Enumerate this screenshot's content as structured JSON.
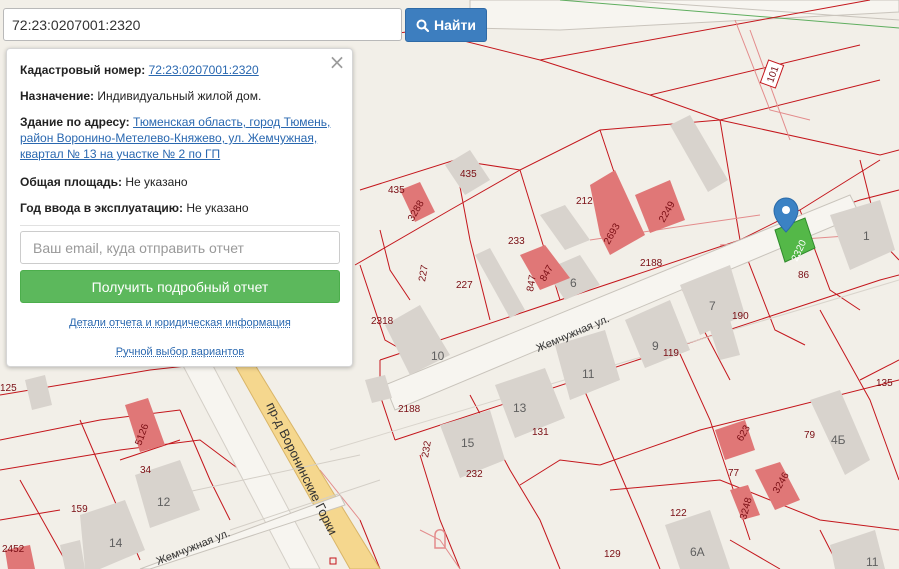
{
  "search": {
    "value": "72:23:0207001:2320",
    "button_label": "Найти"
  },
  "info_panel": {
    "cadastral_label": "Кадастровый номер:",
    "cadastral_value": "72:23:0207001:2320",
    "purpose_label": "Назначение:",
    "purpose_value": "Индивидуальный жилой дом.",
    "address_label": "Здание по адресу:",
    "address_value": "Тюменская область, город Тюмень, район Воронино-Метелево-Княжево, ул. Жемчужная, квартал № 13 на участке № 2 по ГП",
    "area_label": "Общая площадь:",
    "area_value": "Не указано",
    "year_label": "Год ввода в эксплуатацию:",
    "year_value": "Не указано",
    "email_placeholder": "Ваш email, куда отправить отчет",
    "report_button": "Получить подробный отчет",
    "details_link": "Детали отчета и юридическая информация",
    "manual_link": "Ручной выбор вариантов",
    "close_icon": "close-x-icon"
  },
  "map": {
    "colors": {
      "background": "#f2efe8",
      "parcel_border": "#c4161c",
      "building_red": "#e07777",
      "building_gray": "#d8d3cd",
      "selected": "#54b848",
      "marker": "#3b82c4",
      "road_yellow": "#f5d78e"
    },
    "marker_icon": "map-pin-icon",
    "streets": {
      "zhemchuzhnaya_main": "Жемчужная ул.",
      "zhemchuzhnaya_lower": "Жемчужная ул.",
      "voroninskie_gorki": "пр-д Воронинские Горки"
    },
    "road_shield": "101",
    "parcel_labels": {
      "p435a": "435",
      "p435b": "435",
      "p212": "212",
      "p233": "233",
      "p227a": "227",
      "p227b": "227",
      "p2318": "2318",
      "p2188a": "2188",
      "p2188b": "2188",
      "p6": "6",
      "p847": "847",
      "p190": "190",
      "p119": "119",
      "p86": "86",
      "p131": "131",
      "p232a": "232",
      "p232b": "232",
      "p125": "125",
      "p34": "34",
      "p159": "159",
      "p2452": "2452",
      "p135": "135",
      "p79": "79",
      "p77": "77",
      "p122": "122",
      "p129": "129"
    },
    "building_cadastral_labels": {
      "b3288": "3288",
      "b2693": "2693",
      "b2249": "2249",
      "b847": "847",
      "b2320": "2320",
      "b5126": "5126",
      "b623": "623",
      "b3246": "3246",
      "b3248": "3248"
    },
    "house_numbers": {
      "h1": "1",
      "h7": "7",
      "h9": "9",
      "h10": "10",
      "h11a": "11",
      "h13": "13",
      "h15": "15",
      "h12": "12",
      "h14": "14",
      "h4b": "4Б",
      "h6a": "6А",
      "h11b": "11"
    }
  }
}
